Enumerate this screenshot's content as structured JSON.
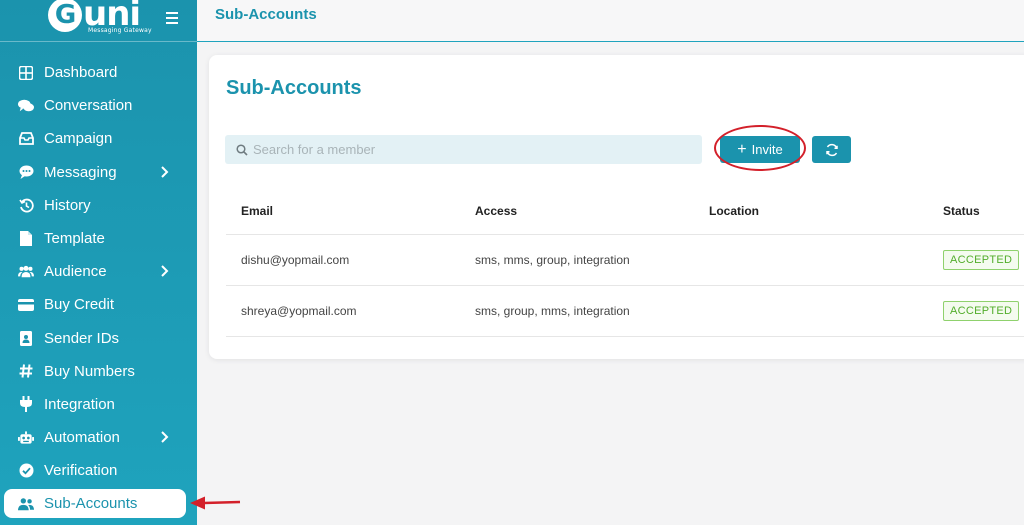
{
  "app": {
    "logo_text": "uni",
    "logo_g": "G",
    "logo_subtitle": "Messaging Gateway"
  },
  "sidebar": {
    "items": [
      {
        "label": "Dashboard",
        "icon": "grid-icon",
        "has_chevron": false
      },
      {
        "label": "Conversation",
        "icon": "chat-bubbles-icon",
        "has_chevron": false
      },
      {
        "label": "Campaign",
        "icon": "inbox-tray-icon",
        "has_chevron": false
      },
      {
        "label": "Messaging",
        "icon": "speech-bubble-icon",
        "has_chevron": true
      },
      {
        "label": "History",
        "icon": "history-icon",
        "has_chevron": false
      },
      {
        "label": "Template",
        "icon": "file-icon",
        "has_chevron": false
      },
      {
        "label": "Audience",
        "icon": "users-icon",
        "has_chevron": true
      },
      {
        "label": "Buy Credit",
        "icon": "credit-card-icon",
        "has_chevron": false
      },
      {
        "label": "Sender IDs",
        "icon": "id-badge-icon",
        "has_chevron": false
      },
      {
        "label": "Buy Numbers",
        "icon": "hash-icon",
        "has_chevron": false
      },
      {
        "label": "Integration",
        "icon": "plug-icon",
        "has_chevron": false
      },
      {
        "label": "Automation",
        "icon": "robot-icon",
        "has_chevron": true
      },
      {
        "label": "Verification",
        "icon": "check-circle-icon",
        "has_chevron": false
      },
      {
        "label": "Sub-Accounts",
        "icon": "user-group-icon",
        "has_chevron": false,
        "active": true
      }
    ]
  },
  "topbar": {
    "title": "Sub-Accounts"
  },
  "main": {
    "title": "Sub-Accounts",
    "search_placeholder": "Search for a member",
    "invite_label": "Invite",
    "table": {
      "headers": [
        "Email",
        "Access",
        "Location",
        "Status"
      ],
      "rows": [
        {
          "email": "dishu@yopmail.com",
          "access": "sms, mms, group, integration",
          "location": "",
          "status": "ACCEPTED"
        },
        {
          "email": "shreya@yopmail.com",
          "access": "sms, group, mms, integration",
          "location": "",
          "status": "ACCEPTED"
        }
      ]
    }
  },
  "colors": {
    "brand": "#1b93ad",
    "annotation": "#d3202a",
    "status_accepted": "#52ad2b"
  }
}
